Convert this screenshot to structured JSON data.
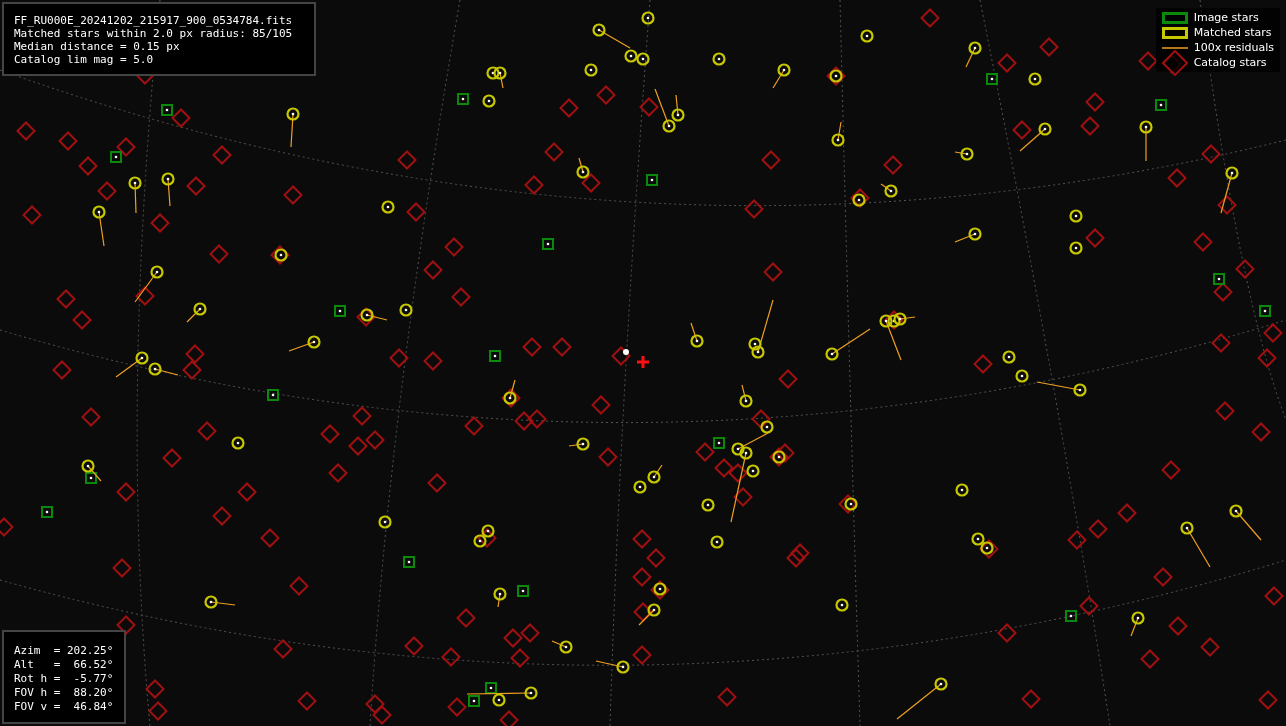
{
  "info_box": {
    "lines": [
      "FF_RU000E_20241202_215917_900_0534784.fits",
      "Matched stars within 2.0 px radius: 85/105",
      "Median distance = 0.15 px",
      "Catalog lim mag = 5.0"
    ]
  },
  "legend": {
    "items": [
      {
        "kind": "image",
        "label": "Image stars"
      },
      {
        "kind": "matched",
        "label": "Matched stars"
      },
      {
        "kind": "residual",
        "label": "100x residuals"
      },
      {
        "kind": "catalog",
        "label": "Catalog stars"
      }
    ]
  },
  "pointing_box": {
    "lines": [
      "Azim  = 202.25°",
      "Alt   =  66.52°",
      "Rot h =  -5.77°",
      "FOV h =  88.20°",
      "FOV v =  46.84°"
    ]
  }
}
